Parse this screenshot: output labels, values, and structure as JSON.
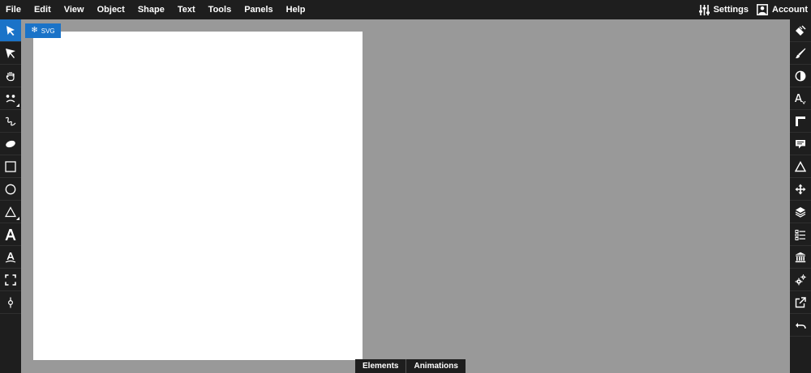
{
  "menubar": {
    "items": [
      {
        "label": "File"
      },
      {
        "label": "Edit"
      },
      {
        "label": "View"
      },
      {
        "label": "Object"
      },
      {
        "label": "Shape"
      },
      {
        "label": "Text"
      },
      {
        "label": "Tools"
      },
      {
        "label": "Panels"
      },
      {
        "label": "Help"
      }
    ],
    "settings_label": "Settings",
    "account_label": "Account"
  },
  "canvas": {
    "badge_label": "SVG"
  },
  "bottom_tabs": [
    {
      "label": "Elements"
    },
    {
      "label": "Animations"
    }
  ],
  "left_tools": [
    "select-icon",
    "node-select-icon",
    "hand-icon",
    "character-icon",
    "pen-icon",
    "ellipse-brush-icon",
    "rectangle-icon",
    "circle-icon",
    "triangle-icon",
    "text-icon",
    "text-path-icon",
    "fullscreen-icon",
    "node-icon"
  ],
  "right_tools": [
    "fill-bucket-icon",
    "brush-icon",
    "contrast-icon",
    "font-size-icon",
    "ruler-icon",
    "speech-bubble-icon",
    "triangle-outline-icon",
    "move-icon",
    "layers-icon",
    "list-icon",
    "library-icon",
    "gears-icon",
    "export-icon",
    "undo-icon"
  ],
  "colors": {
    "accent": "#1a73c8",
    "workspace": "#999999",
    "chrome": "#1e1e1e",
    "paper": "#ffffff"
  }
}
